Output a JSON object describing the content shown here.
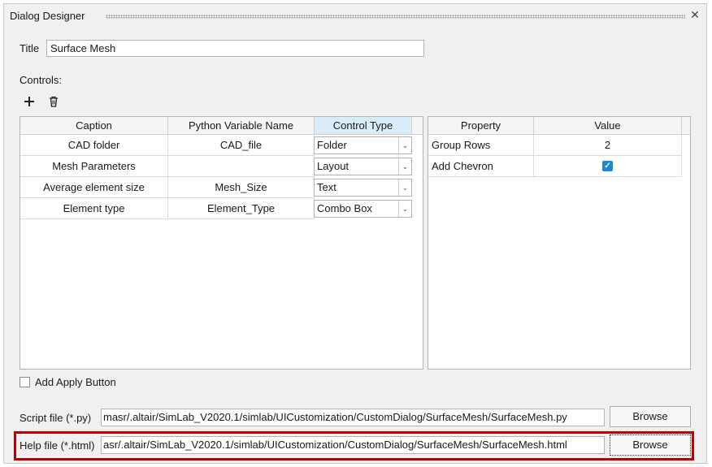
{
  "window": {
    "title": "Dialog Designer",
    "close_glyph": "✕"
  },
  "title_field": {
    "label": "Title",
    "value": "Surface Mesh"
  },
  "controls": {
    "label": "Controls:",
    "add_icon": "plus-icon",
    "delete_icon": "trash-icon"
  },
  "controls_table": {
    "headers": [
      "Caption",
      "Python Variable Name",
      "Control Type"
    ],
    "rows": [
      {
        "caption": "CAD folder",
        "variable": "CAD_file",
        "type": "Folder"
      },
      {
        "caption": "Mesh Parameters",
        "variable": "",
        "type": "Layout"
      },
      {
        "caption": "Average element size",
        "variable": "Mesh_Size",
        "type": "Text"
      },
      {
        "caption": "Element type",
        "variable": "Element_Type",
        "type": "Combo Box"
      }
    ],
    "dropdown_glyph": "⌄"
  },
  "property_table": {
    "headers": [
      "Property",
      "Value"
    ],
    "rows": [
      {
        "property": "Group Rows",
        "value": "2"
      },
      {
        "property": "Add Chevron",
        "value_checked": true,
        "check_glyph": "✓"
      }
    ]
  },
  "apply_button_option": {
    "label": "Add Apply Button",
    "checked": false
  },
  "script_file": {
    "label": "Script file (*.py)",
    "value": "masr/.altair/SimLab_V2020.1/simlab/UICustomization/CustomDialog/SurfaceMesh/SurfaceMesh.py",
    "browse_label": "Browse"
  },
  "help_file": {
    "label": "Help file (*.html)",
    "value": "asr/.altair/SimLab_V2020.1/simlab/UICustomization/CustomDialog/SurfaceMesh/SurfaceMesh.html",
    "browse_label": "Browse"
  },
  "colors": {
    "highlight": "#c00000",
    "header_active": "#d9ecf8",
    "check_blue": "#1e88d8"
  }
}
